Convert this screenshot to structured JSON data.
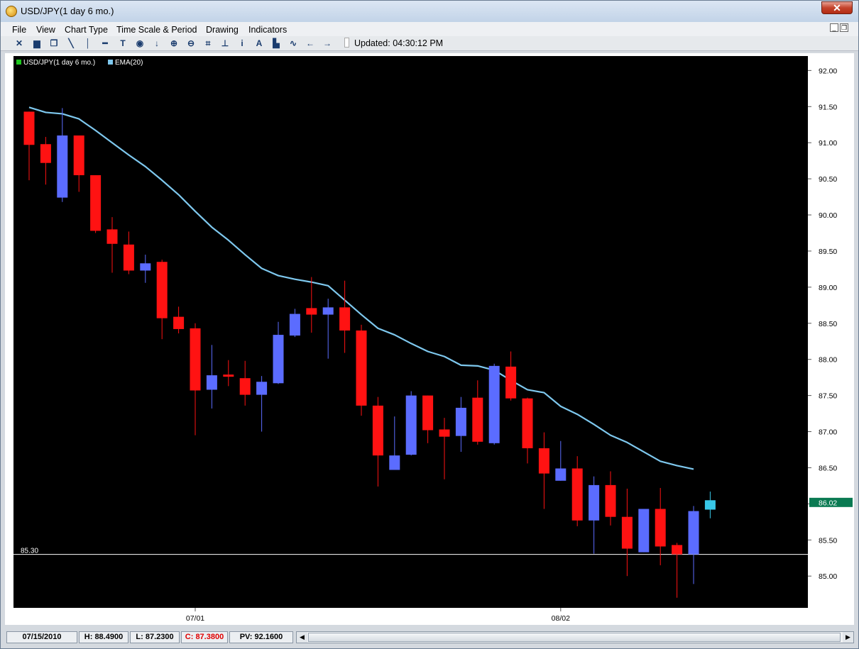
{
  "window": {
    "title": "USD/JPY(1 day  6 mo.)",
    "close_label": "✕",
    "restore_label": "❐",
    "minimize_label": "_"
  },
  "menu": [
    "File",
    "View",
    "Chart Type",
    "Time Scale & Period",
    "Drawing",
    "Indicators"
  ],
  "toolbar": {
    "icons": [
      {
        "name": "crosshair-icon",
        "glyph": "✕"
      },
      {
        "name": "print-icon",
        "glyph": "▆"
      },
      {
        "name": "copy-icon",
        "glyph": "❐"
      },
      {
        "name": "trendline-icon",
        "glyph": "╲"
      },
      {
        "name": "vertical-line-icon",
        "glyph": "│"
      },
      {
        "name": "horizontal-line-icon",
        "glyph": "━"
      },
      {
        "name": "text-icon",
        "glyph": "T"
      },
      {
        "name": "marker-icon",
        "glyph": "◉"
      },
      {
        "name": "arrow-down-icon",
        "glyph": "↓"
      },
      {
        "name": "zoom-in-icon",
        "glyph": "⊕"
      },
      {
        "name": "zoom-out-icon",
        "glyph": "⊖"
      },
      {
        "name": "fit-icon",
        "glyph": "⌗"
      },
      {
        "name": "anchor-icon",
        "glyph": "⊥"
      },
      {
        "name": "info-icon",
        "glyph": "i"
      },
      {
        "name": "font-icon",
        "glyph": "A"
      },
      {
        "name": "bar-chart-icon",
        "glyph": "▙"
      },
      {
        "name": "line-chart-icon",
        "glyph": "∿"
      },
      {
        "name": "arrow-left-icon",
        "glyph": "←"
      },
      {
        "name": "arrow-right-icon",
        "glyph": "→"
      }
    ],
    "updated": "Updated: 04:30:12 PM"
  },
  "status": {
    "date": "07/15/2010",
    "high": "H: 88.4900",
    "low": "L: 87.2300",
    "close": "C: 87.3800",
    "pv": "PV: 92.1600",
    "scroll_left": "◀",
    "scroll_right": "▶"
  },
  "colors": {
    "bull": "#5b6cff",
    "bear": "#ff1212",
    "ema": "#7ec8ee",
    "last": "#38c7e8",
    "price_tag": "#0a7a52"
  },
  "chart_data": {
    "type": "candlestick",
    "legend": [
      "USD/JPY(1 day  6 mo.)",
      "EMA(20)"
    ],
    "legend_placement": "top-left",
    "y_ticks": [
      "92.00",
      "91.50",
      "91.00",
      "90.50",
      "90.00",
      "89.50",
      "89.00",
      "88.50",
      "88.00",
      "87.50",
      "87.00",
      "86.50",
      "86.00",
      "85.50",
      "85.00"
    ],
    "ylim": [
      84.56,
      92.2
    ],
    "x_labels": [
      {
        "label": "07/01",
        "index": 10
      },
      {
        "label": "08/02",
        "index": 32
      }
    ],
    "price_tag": "86.02",
    "hline": {
      "label": "85.30",
      "value": 85.3
    },
    "candles": [
      {
        "o": 91.43,
        "h": 91.43,
        "l": 90.48,
        "c": 90.97
      },
      {
        "o": 90.98,
        "h": 91.08,
        "l": 90.42,
        "c": 90.72
      },
      {
        "o": 90.24,
        "h": 91.48,
        "l": 90.18,
        "c": 91.1
      },
      {
        "o": 91.1,
        "h": 91.1,
        "l": 90.32,
        "c": 90.55
      },
      {
        "o": 90.55,
        "h": 90.55,
        "l": 89.75,
        "c": 89.78
      },
      {
        "o": 89.8,
        "h": 89.97,
        "l": 89.2,
        "c": 89.6
      },
      {
        "o": 89.59,
        "h": 89.77,
        "l": 89.18,
        "c": 89.23
      },
      {
        "o": 89.23,
        "h": 89.45,
        "l": 89.06,
        "c": 89.33
      },
      {
        "o": 89.35,
        "h": 89.38,
        "l": 88.28,
        "c": 88.57
      },
      {
        "o": 88.59,
        "h": 88.73,
        "l": 88.36,
        "c": 88.42
      },
      {
        "o": 88.43,
        "h": 88.5,
        "l": 86.95,
        "c": 87.57
      },
      {
        "o": 87.58,
        "h": 88.2,
        "l": 87.32,
        "c": 87.78
      },
      {
        "o": 87.79,
        "h": 87.99,
        "l": 87.63,
        "c": 87.76
      },
      {
        "o": 87.74,
        "h": 87.98,
        "l": 87.36,
        "c": 87.51
      },
      {
        "o": 87.51,
        "h": 87.77,
        "l": 87.0,
        "c": 87.69
      },
      {
        "o": 87.67,
        "h": 88.52,
        "l": 87.66,
        "c": 88.34
      },
      {
        "o": 88.33,
        "h": 88.7,
        "l": 88.31,
        "c": 88.63
      },
      {
        "o": 88.71,
        "h": 89.14,
        "l": 88.37,
        "c": 88.62
      },
      {
        "o": 88.62,
        "h": 88.84,
        "l": 88.01,
        "c": 88.72
      },
      {
        "o": 88.72,
        "h": 89.09,
        "l": 88.09,
        "c": 88.4
      },
      {
        "o": 88.4,
        "h": 88.48,
        "l": 87.22,
        "c": 87.36
      },
      {
        "o": 87.36,
        "h": 87.48,
        "l": 86.24,
        "c": 86.67
      },
      {
        "o": 86.47,
        "h": 87.21,
        "l": 86.47,
        "c": 86.67
      },
      {
        "o": 86.68,
        "h": 87.56,
        "l": 86.67,
        "c": 87.5
      },
      {
        "o": 87.5,
        "h": 87.5,
        "l": 86.84,
        "c": 87.02
      },
      {
        "o": 87.03,
        "h": 87.19,
        "l": 86.34,
        "c": 86.93
      },
      {
        "o": 86.94,
        "h": 87.48,
        "l": 86.72,
        "c": 87.33
      },
      {
        "o": 87.47,
        "h": 87.71,
        "l": 86.82,
        "c": 86.86
      },
      {
        "o": 86.84,
        "h": 87.94,
        "l": 86.82,
        "c": 87.91
      },
      {
        "o": 87.9,
        "h": 88.11,
        "l": 87.43,
        "c": 87.46
      },
      {
        "o": 87.46,
        "h": 87.47,
        "l": 86.56,
        "c": 86.77
      },
      {
        "o": 86.77,
        "h": 86.99,
        "l": 85.93,
        "c": 86.42
      },
      {
        "o": 86.32,
        "h": 86.87,
        "l": 86.32,
        "c": 86.49
      },
      {
        "o": 86.49,
        "h": 86.66,
        "l": 85.69,
        "c": 85.77
      },
      {
        "o": 85.77,
        "h": 86.38,
        "l": 85.31,
        "c": 86.26
      },
      {
        "o": 86.26,
        "h": 86.45,
        "l": 85.7,
        "c": 85.82
      },
      {
        "o": 85.82,
        "h": 86.21,
        "l": 85.0,
        "c": 85.38
      },
      {
        "o": 85.33,
        "h": 85.93,
        "l": 85.33,
        "c": 85.93
      },
      {
        "o": 85.93,
        "h": 86.22,
        "l": 85.15,
        "c": 85.41
      },
      {
        "o": 85.43,
        "h": 85.46,
        "l": 84.7,
        "c": 85.3
      },
      {
        "o": 85.3,
        "h": 85.97,
        "l": 84.89,
        "c": 85.9
      },
      {
        "o": 85.92,
        "h": 86.17,
        "l": 85.8,
        "c": 86.05,
        "current": true
      }
    ],
    "ema": [
      91.49,
      91.42,
      91.4,
      91.33,
      91.17,
      91.0,
      90.83,
      90.67,
      90.48,
      90.28,
      90.05,
      89.83,
      89.65,
      89.45,
      89.26,
      89.16,
      89.11,
      89.07,
      89.02,
      88.82,
      88.62,
      88.43,
      88.34,
      88.22,
      88.11,
      88.04,
      87.92,
      87.91,
      87.85,
      87.71,
      87.58,
      87.54,
      87.35,
      87.24,
      87.1,
      86.95,
      86.85,
      86.72,
      86.59,
      86.53,
      86.48
    ]
  }
}
